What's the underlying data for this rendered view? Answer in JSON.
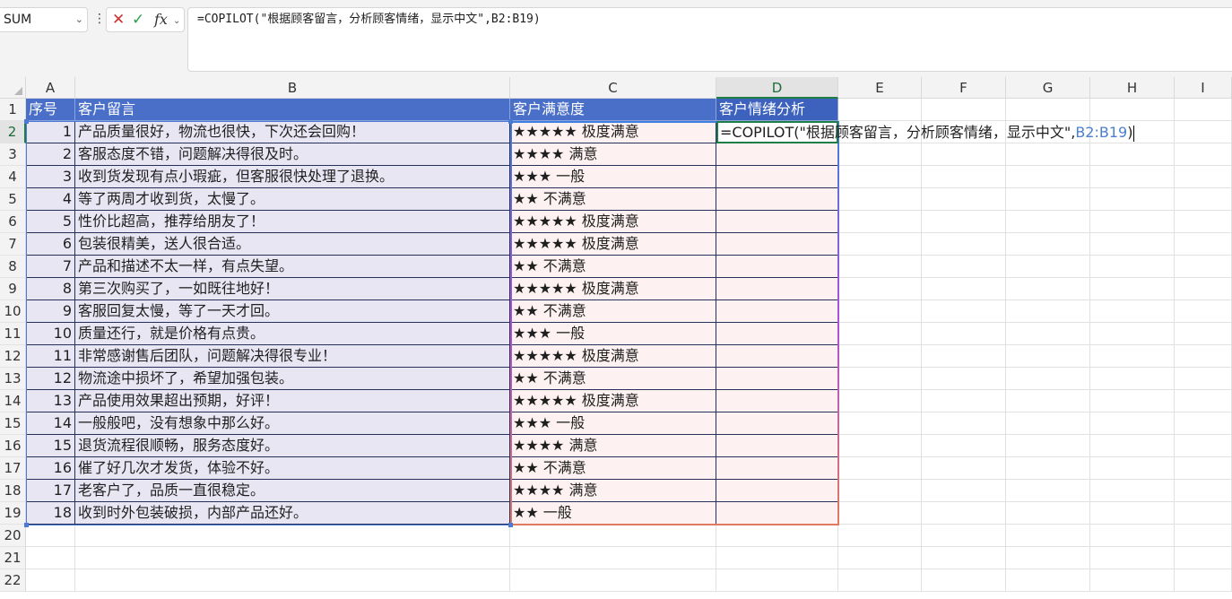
{
  "formula_bar": {
    "name_box": "SUM",
    "formula": "=COPILOT(\"根据顾客留言，分析顾客情绪，显示中文\",B2:B19)"
  },
  "columns": [
    "A",
    "B",
    "C",
    "D",
    "E",
    "F",
    "G",
    "H",
    "I"
  ],
  "row_numbers": [
    "1",
    "2",
    "3",
    "4",
    "5",
    "6",
    "7",
    "8",
    "9",
    "10",
    "11",
    "12",
    "13",
    "14",
    "15",
    "16",
    "17",
    "18",
    "19",
    "20",
    "21",
    "22"
  ],
  "table": {
    "headers": [
      "序号",
      "客户留言",
      "客户满意度",
      "客户情绪分析"
    ],
    "rows": [
      [
        "1",
        "产品质量很好，物流也很快，下次还会回购！",
        "★★★★★ 极度满意"
      ],
      [
        "2",
        "客服态度不错，问题解决得很及时。",
        "★★★★ 满意"
      ],
      [
        "3",
        "收到货发现有点小瑕疵，但客服很快处理了退换。",
        "★★★ 一般"
      ],
      [
        "4",
        "等了两周才收到货，太慢了。",
        "★★ 不满意"
      ],
      [
        "5",
        "性价比超高，推荐给朋友了！",
        "★★★★★ 极度满意"
      ],
      [
        "6",
        "包装很精美，送人很合适。",
        "★★★★★ 极度满意"
      ],
      [
        "7",
        "产品和描述不太一样，有点失望。",
        "★★ 不满意"
      ],
      [
        "8",
        "第三次购买了，一如既往地好！",
        "★★★★★ 极度满意"
      ],
      [
        "9",
        "客服回复太慢，等了一天才回。",
        "★★ 不满意"
      ],
      [
        "10",
        "质量还行，就是价格有点贵。",
        "★★★ 一般"
      ],
      [
        "11",
        "非常感谢售后团队，问题解决得很专业！",
        "★★★★★ 极度满意"
      ],
      [
        "12",
        "物流途中损坏了，希望加强包装。",
        "★★ 不满意"
      ],
      [
        "13",
        "产品使用效果超出预期，好评！",
        "★★★★★ 极度满意"
      ],
      [
        "14",
        "一般般吧，没有想象中那么好。",
        "★★★ 一般"
      ],
      [
        "15",
        "退货流程很顺畅，服务态度好。",
        "★★★★ 满意"
      ],
      [
        "16",
        "催了好几次才发货，体验不好。",
        "★★ 不满意"
      ],
      [
        "17",
        "老客户了，品质一直很稳定。",
        "★★★★ 满意"
      ],
      [
        "18",
        "收到时外包装破损，内部产品还好。",
        "★★ 一般"
      ]
    ]
  },
  "editing_cell": {
    "text_prefix": "=COPILOT(\"根据顾客留言，分析顾客情绪，显示中文\",",
    "range_ref": "B2:B19",
    "text_suffix": ")"
  }
}
